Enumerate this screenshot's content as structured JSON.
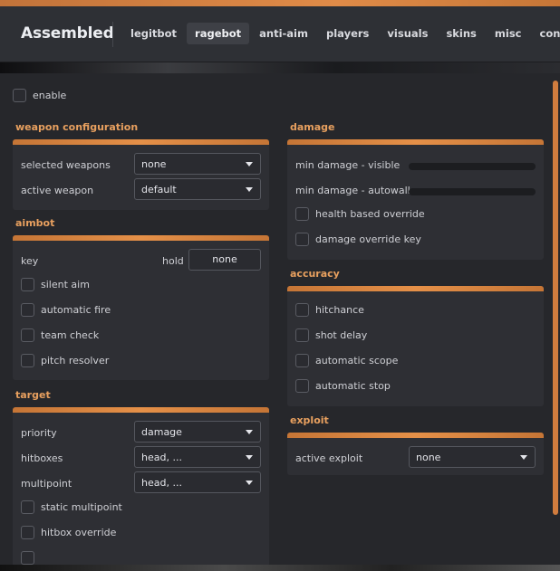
{
  "app": {
    "title": "Assembled"
  },
  "tabs": [
    {
      "label": "legitbot",
      "active": false
    },
    {
      "label": "ragebot",
      "active": true
    },
    {
      "label": "anti-aim",
      "active": false
    },
    {
      "label": "players",
      "active": false
    },
    {
      "label": "visuals",
      "active": false
    },
    {
      "label": "skins",
      "active": false
    },
    {
      "label": "misc",
      "active": false
    },
    {
      "label": "config",
      "active": false
    }
  ],
  "enable": {
    "label": "enable",
    "checked": false
  },
  "weapon_configuration": {
    "title": "weapon configuration",
    "selected_weapons": {
      "label": "selected weapons",
      "value": "none"
    },
    "active_weapon": {
      "label": "active weapon",
      "value": "default"
    }
  },
  "aimbot": {
    "title": "aimbot",
    "key_label": "key",
    "hold_label": "hold",
    "key_value": "none",
    "checkboxes": [
      "silent aim",
      "automatic fire",
      "team check",
      "pitch resolver"
    ]
  },
  "target": {
    "title": "target",
    "priority": {
      "label": "priority",
      "value": "damage"
    },
    "hitboxes": {
      "label": "hitboxes",
      "value": "head, ..."
    },
    "multipoint": {
      "label": "multipoint",
      "value": "head, ..."
    },
    "checkboxes": [
      "static multipoint",
      "hitbox override"
    ]
  },
  "damage": {
    "title": "damage",
    "min_visible": {
      "label": "min damage - visible",
      "value": 0
    },
    "min_autowall": {
      "label": "min damage - autowall",
      "value": 0
    },
    "checkboxes": [
      "health based override",
      "damage override key"
    ]
  },
  "accuracy": {
    "title": "accuracy",
    "checkboxes": [
      "hitchance",
      "shot delay",
      "automatic scope",
      "automatic stop"
    ]
  },
  "exploit": {
    "title": "exploit",
    "active_exploit": {
      "label": "active exploit",
      "value": "none"
    }
  },
  "colors": {
    "accent": "#e08b48",
    "title": "#e8a05f",
    "panel": "#26272b"
  }
}
